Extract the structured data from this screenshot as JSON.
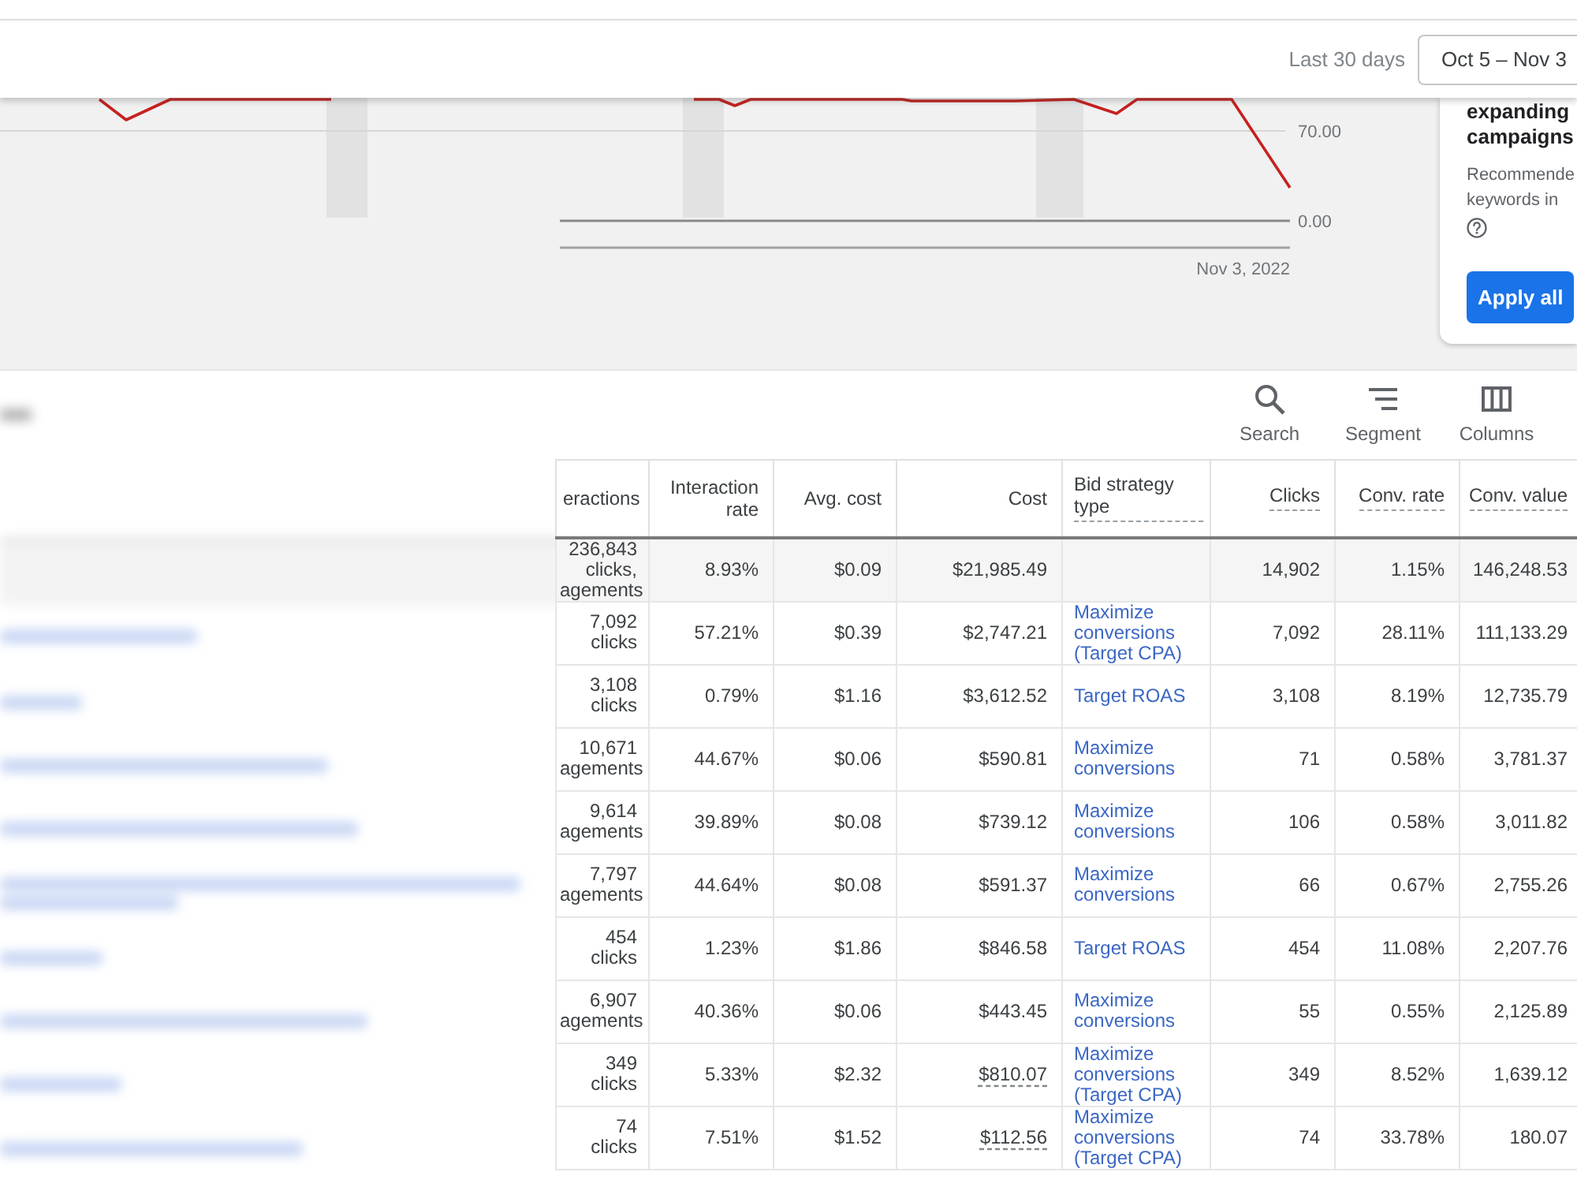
{
  "top_bar": {
    "period_label": "Last 30 days",
    "date_range": "Oct 5 – Nov 3"
  },
  "chart": {
    "y_tick_labels": [
      "70.00",
      "0.00"
    ],
    "x_tick_label": "Nov 3, 2022"
  },
  "recommendation_card": {
    "title_lines": [
      "expanding",
      "campaigns"
    ],
    "description_lines": [
      "Recommende",
      "keywords in"
    ],
    "button": "Apply all"
  },
  "toolbar": [
    {
      "kind": "search",
      "label": "Search"
    },
    {
      "kind": "segment",
      "label": "Segment"
    },
    {
      "kind": "columns",
      "label": "Columns"
    }
  ],
  "table": {
    "columns": [
      {
        "label": "eractions",
        "kind": "number",
        "underlined": false
      },
      {
        "label": "Interaction rate",
        "kind": "number",
        "underlined": false
      },
      {
        "label": "Avg. cost",
        "kind": "number",
        "underlined": false
      },
      {
        "label": "Cost",
        "kind": "number",
        "underlined": false
      },
      {
        "label": "Bid strategy type",
        "kind": "link",
        "underlined": true
      },
      {
        "label": "Clicks",
        "kind": "number",
        "underlined": true
      },
      {
        "label": "Conv. rate",
        "kind": "number",
        "underlined": true
      },
      {
        "label": "Conv. value",
        "kind": "number",
        "underlined": true
      }
    ],
    "rows": [
      {
        "kind": "total",
        "cost_underlined": false,
        "cells": [
          [
            "236,843",
            "clicks,",
            "agements"
          ],
          "8.93%",
          "$0.09",
          "$21,985.49",
          null,
          "14,902",
          "1.15%",
          "146,248.53"
        ]
      },
      {
        "kind": "campaign",
        "cost_underlined": false,
        "cells": [
          [
            "7,092",
            "clicks"
          ],
          "57.21%",
          "$0.39",
          "$2,747.21",
          "Maximize conversions (Target CPA)",
          "7,092",
          "28.11%",
          "111,133.29"
        ]
      },
      {
        "kind": "campaign",
        "cost_underlined": false,
        "cells": [
          [
            "3,108",
            "clicks"
          ],
          "0.79%",
          "$1.16",
          "$3,612.52",
          "Target ROAS",
          "3,108",
          "8.19%",
          "12,735.79"
        ]
      },
      {
        "kind": "campaign",
        "cost_underlined": false,
        "cells": [
          [
            "10,671",
            "agements"
          ],
          "44.67%",
          "$0.06",
          "$590.81",
          "Maximize conversions",
          "71",
          "0.58%",
          "3,781.37"
        ]
      },
      {
        "kind": "campaign",
        "cost_underlined": false,
        "cells": [
          [
            "9,614",
            "agements"
          ],
          "39.89%",
          "$0.08",
          "$739.12",
          "Maximize conversions",
          "106",
          "0.58%",
          "3,011.82"
        ]
      },
      {
        "kind": "campaign",
        "cost_underlined": false,
        "cells": [
          [
            "7,797",
            "agements"
          ],
          "44.64%",
          "$0.08",
          "$591.37",
          "Maximize conversions",
          "66",
          "0.67%",
          "2,755.26"
        ]
      },
      {
        "kind": "campaign",
        "cost_underlined": false,
        "cells": [
          [
            "454",
            "clicks"
          ],
          "1.23%",
          "$1.86",
          "$846.58",
          "Target ROAS",
          "454",
          "11.08%",
          "2,207.76"
        ]
      },
      {
        "kind": "campaign",
        "cost_underlined": false,
        "cells": [
          [
            "6,907",
            "agements"
          ],
          "40.36%",
          "$0.06",
          "$443.45",
          "Maximize conversions",
          "55",
          "0.55%",
          "2,125.89"
        ]
      },
      {
        "kind": "campaign",
        "cost_underlined": true,
        "cells": [
          [
            "349",
            "clicks"
          ],
          "5.33%",
          "$2.32",
          "$810.07",
          "Maximize conversions (Target CPA)",
          "349",
          "8.52%",
          "1,639.12"
        ]
      },
      {
        "kind": "campaign",
        "cost_underlined": true,
        "cells": [
          [
            "74",
            "clicks"
          ],
          "7.51%",
          "$1.52",
          "$112.56",
          "Maximize conversions (Target CPA)",
          "74",
          "33.78%",
          "180.07"
        ]
      }
    ]
  }
}
